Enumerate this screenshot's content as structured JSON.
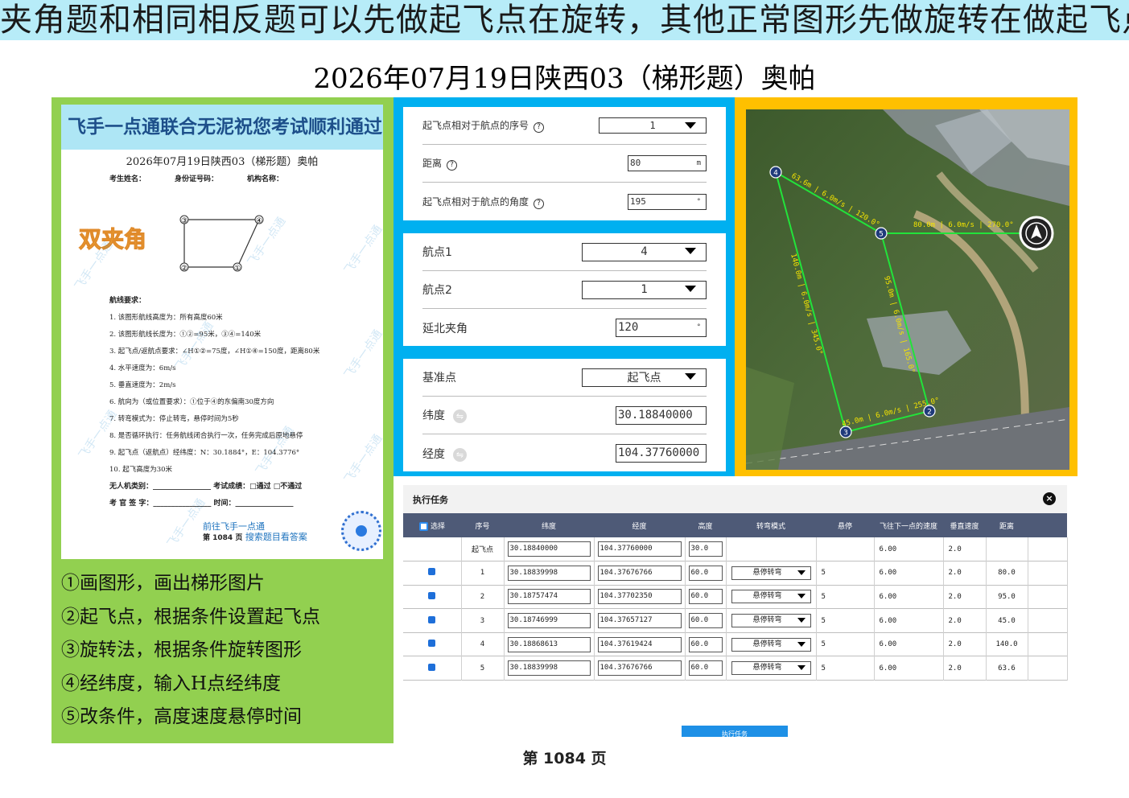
{
  "banner": "夹角题和相同相反题可以先做起飞点在旋转，其他正常图形先做旋转在做起飞点",
  "main_title": "2026年07月19日陕西03（梯形题）奥帕",
  "paper": {
    "banner": "飞手一点通联合无泥祝您考试顺利通过",
    "title": "2026年07月19日陕西03（梯形题）奥帕",
    "field_name": "考生姓名：",
    "field_id": "身份证号码：",
    "field_org": "机构名称：",
    "badge": "双夹角",
    "points": [
      "③",
      "④",
      "②",
      "①"
    ],
    "req_title": "航线要求：",
    "requirements": [
      "1.  该图形航线高度为：所有高度60米",
      "2.  该图形航线长度为：①②=95米，③④=140米",
      "3.  起飞点/返航点要求：∠H①②=75度，∠H①④=150度，距离80米",
      "4.  水平速度为：6m/s",
      "5.  垂直速度为：2m/s",
      "6.  航向为（或位置要求）：①位于④的东偏南30度方向",
      "7.  转弯模式为：停止转弯，悬停时间为5秒",
      "8.  是否循环执行：任务航线闭合执行一次，任务完成后原地悬停",
      "9.  起飞点（返航点）经纬度：N：30.1884°，E：104.3776°",
      "10. 起飞高度为30米"
    ],
    "sign_type": "无人机类别：________________   考试成绩：□通过  □不通过",
    "sign_examiner": "考 官 签 字：________________   时间：________________",
    "promo1": "前往飞手一点通",
    "promo2": "搜索题目看答案",
    "promo_page": "第  1084  页",
    "watermark": "飞手一点通"
  },
  "steps": [
    "①画图形，画出梯形图片",
    "②起飞点，根据条件设置起飞点",
    "③旋转法，根据条件旋转图形",
    "④经纬度，输入H点经纬度",
    "⑤改条件，高度速度悬停时间"
  ],
  "settings": {
    "takeoff_seq_label": "起飞点相对于航点的序号",
    "takeoff_seq_value": "1",
    "distance_label": "距离",
    "distance_value": "80",
    "distance_unit": "m",
    "angle_label": "起飞点相对于航点的角度",
    "angle_value": "195",
    "angle_unit": "°",
    "wp1_label": "航点1",
    "wp1_value": "4",
    "wp2_label": "航点2",
    "wp2_value": "1",
    "north_angle_label": "延北夹角",
    "north_angle_value": "120",
    "north_angle_unit": "°",
    "base_label": "基准点",
    "base_value": "起飞点",
    "lat_label": "纬度",
    "lat_value": "30.18840000",
    "lon_label": "经度",
    "lon_value": "104.37760000",
    "help": "?",
    "swap": "⇋"
  },
  "map": {
    "waypoints": [
      "4",
      "5",
      "2",
      "3"
    ],
    "segment_labels": [
      "63.6m | 6.0m/s | 120.0°",
      "80.0m | 6.0m/s | 270.0°",
      "140.0m | 6.0m/s | 345.0°",
      "95.0m | 6.0m/s | 165.0°",
      "45.0m | 6.0m/s | 255.0°"
    ]
  },
  "task": {
    "title": "执行任务",
    "close": "×",
    "columns": [
      "选择",
      "序号",
      "纬度",
      "经度",
      "高度",
      "转弯模式",
      "悬停",
      "飞往下一点的速度",
      "垂直速度",
      "距离"
    ],
    "rows": [
      {
        "seq": "起飞点",
        "lat": "30.18840000",
        "lon": "104.37760000",
        "alt": "30.0",
        "turn": "",
        "hover": "",
        "speed": "6.00",
        "vspeed": "2.0",
        "dist": ""
      },
      {
        "seq": "1",
        "lat": "30.18839998",
        "lon": "104.37676766",
        "alt": "60.0",
        "turn": "悬停转弯",
        "hover": "5",
        "speed": "6.00",
        "vspeed": "2.0",
        "dist": "80.0"
      },
      {
        "seq": "2",
        "lat": "30.18757474",
        "lon": "104.37702350",
        "alt": "60.0",
        "turn": "悬停转弯",
        "hover": "5",
        "speed": "6.00",
        "vspeed": "2.0",
        "dist": "95.0"
      },
      {
        "seq": "3",
        "lat": "30.18746999",
        "lon": "104.37657127",
        "alt": "60.0",
        "turn": "悬停转弯",
        "hover": "5",
        "speed": "6.00",
        "vspeed": "2.0",
        "dist": "45.0"
      },
      {
        "seq": "4",
        "lat": "30.18868613",
        "lon": "104.37619424",
        "alt": "60.0",
        "turn": "悬停转弯",
        "hover": "5",
        "speed": "6.00",
        "vspeed": "2.0",
        "dist": "140.0"
      },
      {
        "seq": "5",
        "lat": "30.18839998",
        "lon": "104.37676766",
        "alt": "60.0",
        "turn": "悬停转弯",
        "hover": "5",
        "speed": "6.00",
        "vspeed": "2.0",
        "dist": "63.6"
      }
    ],
    "execute_label": "执行任务"
  },
  "page_number": "第  1084  页",
  "colors": {
    "banner_bg": "#b7ecf8",
    "left_panel": "#92d050",
    "blue_panel": "#00b0f0",
    "map_panel": "#ffc000",
    "table_header": "#4e5a77",
    "route_line": "#22e33a",
    "route_label": "#f5e400"
  }
}
